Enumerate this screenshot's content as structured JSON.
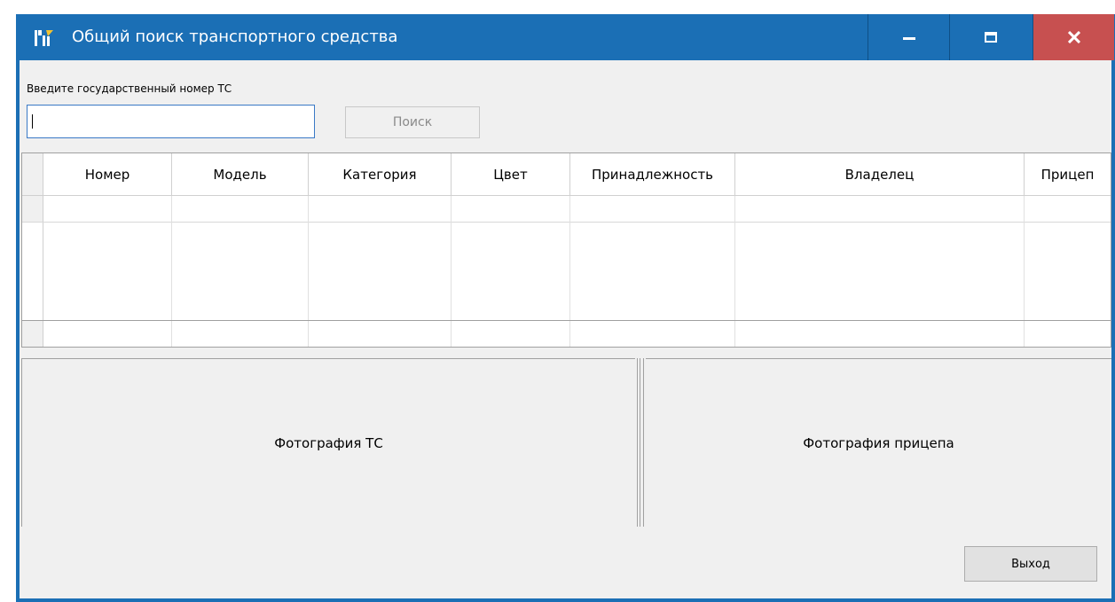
{
  "window": {
    "title": "Общий поиск транспортного средства",
    "icon": "app-logo-icon",
    "controls": {
      "minimize": "minimize-icon",
      "maximize": "maximize-icon",
      "close": "close-icon"
    },
    "colors": {
      "titlebar": "#1b6fb5",
      "close": "#c75050",
      "client": "#f0f0f0"
    }
  },
  "search": {
    "prompt": "Введите государственный номер ТС",
    "value": "",
    "button_label": "Поиск"
  },
  "table": {
    "columns": [
      "Номер",
      "Модель",
      "Категория",
      "Цвет",
      "Принадлежность",
      "Владелец",
      "Прицеп"
    ],
    "rows": []
  },
  "photos": {
    "vehicle_label": "Фотография ТС",
    "trailer_label": "Фотография прицепа"
  },
  "footer": {
    "exit_label": "Выход"
  }
}
